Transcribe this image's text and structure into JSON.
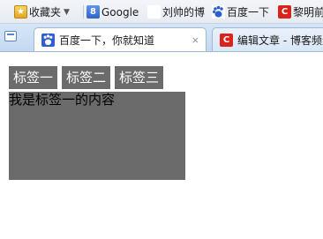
{
  "bookmarks": {
    "favorites_label": "收藏夹",
    "items": [
      {
        "label": "Google",
        "icon": "google-icon",
        "glyph": "8"
      },
      {
        "label": "刘帅的博",
        "icon": "weibo-icon",
        "glyph": "微"
      },
      {
        "label": "百度一下",
        "icon": "baidu-paw-icon",
        "glyph": ""
      },
      {
        "label": "黎明前",
        "icon": "c-logo-icon",
        "glyph": "C"
      }
    ]
  },
  "tabs": [
    {
      "title": "百度一下，你就知道",
      "icon": "baidu-paw-icon",
      "active": true,
      "close": "×"
    },
    {
      "title": "编辑文章 - 博客频道",
      "icon": "c-logo-icon",
      "glyph": "C",
      "active": false
    }
  ],
  "page": {
    "tab_labels": [
      "标签一",
      "标签二",
      "标签三"
    ],
    "panel_text": "我是标签一的内容"
  },
  "colors": {
    "demo_tab_bg": "#6b6b6b",
    "accent_red": "#d8241b",
    "tabbar_blue": "#c3d9f1"
  }
}
